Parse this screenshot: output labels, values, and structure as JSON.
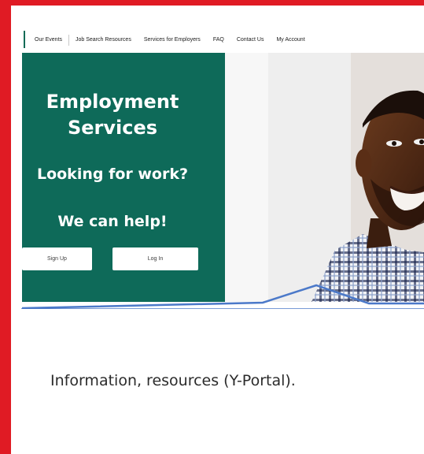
{
  "nav": {
    "items": [
      "Our Events",
      "Job Search Resources",
      "Services for Employers",
      "FAQ",
      "Contact Us",
      "My Account"
    ]
  },
  "hero": {
    "title_line1": "Employment",
    "title_line2": "Services",
    "question": "Looking for work?",
    "help": "We can help!",
    "signup_label": "Sign Up",
    "login_label": "Log In"
  },
  "card": {
    "text": "Information, resources (Y-Portal)."
  },
  "colors": {
    "frame": "#e01b24",
    "hero": "#0e6a59",
    "accent_line": "#4b79c9"
  }
}
